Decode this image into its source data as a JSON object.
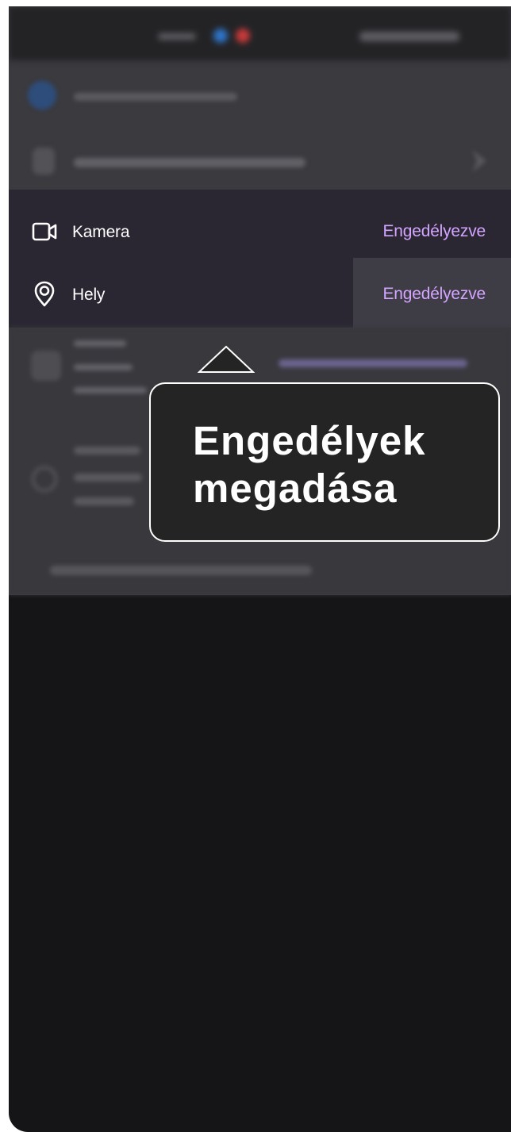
{
  "status_bar": {
    "time_icon": "time-placeholder",
    "left_icons": [
      "blue-app-icon",
      "red-app-icon"
    ],
    "right_icons": "system-status-icons"
  },
  "browser": {
    "blurred_site_row": "blurred-url-row",
    "blurred_tracking_row": "blurred-tracking-row"
  },
  "permissions": [
    {
      "label": "Kamera",
      "status": "Engedélyezve",
      "icon": "camera-icon"
    },
    {
      "label": "Hely",
      "status": "Engedélyezve",
      "icon": "location-pin-icon"
    }
  ],
  "tooltip": {
    "title": "Engedélyek megadása"
  },
  "colors": {
    "accent": "#d4a5ff",
    "panel": "#2a2733",
    "tooltip_background": "#242424",
    "screen_background": "#151417"
  }
}
